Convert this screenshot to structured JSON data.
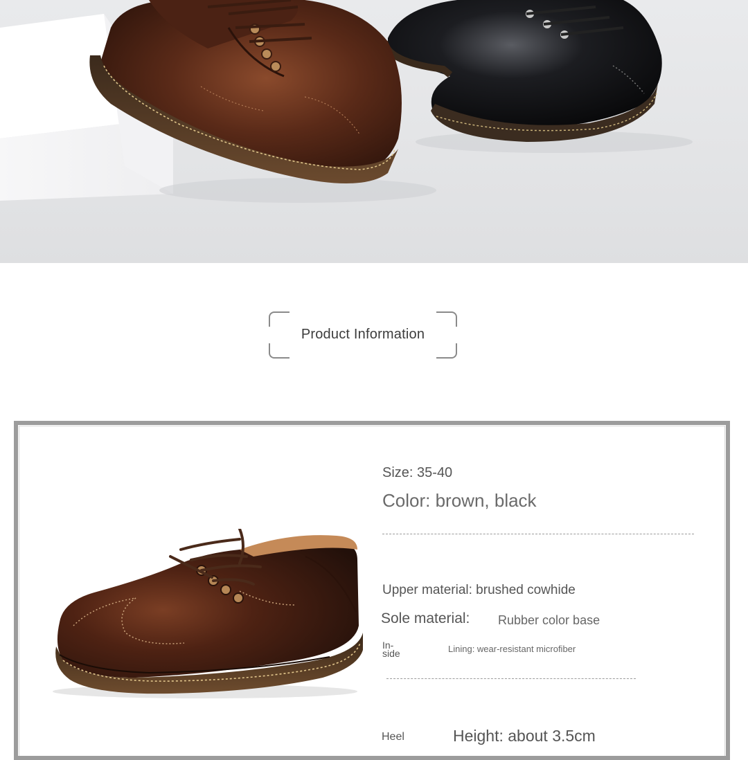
{
  "section": {
    "title": "Product Information"
  },
  "specs": {
    "size": {
      "label": "Size:",
      "value": "35-40"
    },
    "color": {
      "label": "Color:",
      "value": "brown, black"
    },
    "upper": {
      "label": "Upper material:",
      "value": "brushed cowhide"
    },
    "sole": {
      "label": "Sole material:",
      "value": "Rubber color base"
    },
    "lining": {
      "label_line1": "In-",
      "label_line2": "side",
      "value": "Lining: wear-resistant microfiber"
    },
    "heel": {
      "label": "Heel",
      "value": "Height: about 3.5cm"
    }
  },
  "colors": {
    "brown": "#4a2416",
    "black": "#0e0e10",
    "frame": "#9c9c9c"
  }
}
